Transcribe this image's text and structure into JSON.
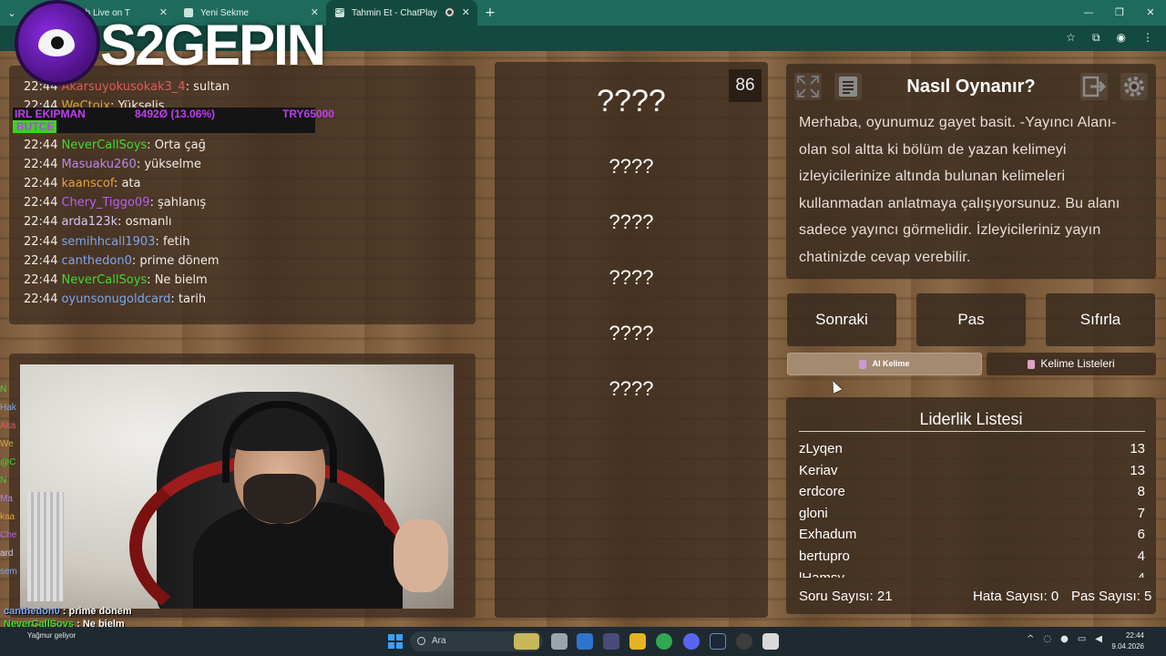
{
  "browser": {
    "tabs": [
      {
        "label": "m - Watch Live on T",
        "favicon": "twitch-icon"
      },
      {
        "label": "Yeni Sekme",
        "favicon": "newtab-icon"
      },
      {
        "label": "Tahmin Et - ChatPlay",
        "favicon": "chatplay-icon",
        "favicon_text": "CP"
      }
    ],
    "new_tab": "+"
  },
  "overlay": {
    "logo_text": "S2GEPIN"
  },
  "chat": {
    "partial_lines": [
      {
        "user": "Akarsuyokusokak3_4",
        "time": "22:44",
        "message": "sultan",
        "color": "#e05a5a"
      },
      {
        "user": "WeCtoix",
        "time": "22:44",
        "message": "Yükselis",
        "color": "#d4a838"
      }
    ],
    "lines": [
      {
        "time": "22:44",
        "user": "NeverCallSoys",
        "message": "Orta çağ",
        "color": "#3fdb2e"
      },
      {
        "time": "22:44",
        "user": "Masuaku260",
        "message": "yükselme",
        "color": "#b688f2"
      },
      {
        "time": "22:44",
        "user": "kaanscof",
        "message": "ata",
        "color": "#e8a23a"
      },
      {
        "time": "22:44",
        "user": "Chery_Tiggo09",
        "message": "şahlanış",
        "color": "#b65ff0"
      },
      {
        "time": "22:44",
        "user": "arda123k",
        "message": "osmanlı",
        "color": "#d3c7f7"
      },
      {
        "time": "22:44",
        "user": "semihhcall1903",
        "message": "fetih",
        "color": "#7aa7f2"
      },
      {
        "time": "22:44",
        "user": "canthedon0",
        "message": "prime dönem",
        "color": "#7aa7f2"
      },
      {
        "time": "22:44",
        "user": "NeverCallSoys",
        "message": "Ne bielm",
        "color": "#3fdb2e"
      },
      {
        "time": "22:44",
        "user": "oyunsonugoldcard",
        "message": "tarih",
        "color": "#7aa7f2"
      }
    ]
  },
  "ticker": {
    "left": "IRL EKIPMAN",
    "mid": "8492Ø (13.06%)",
    "right": "TRY65000",
    "bottom": "BUTCE"
  },
  "cam_side_chat": [
    {
      "text": "N",
      "color": "#3fdb2e"
    },
    {
      "text": "Hak",
      "color": "#7aa7f2"
    },
    {
      "text": "Aka",
      "color": "#e05a5a"
    },
    {
      "text": "We",
      "color": "#d4a838"
    },
    {
      "text": "@C",
      "color": "#3fdb2e"
    },
    {
      "text": "N",
      "color": "#3fdb2e"
    },
    {
      "text": "Ma",
      "color": "#b688f2"
    },
    {
      "text": "kaa",
      "color": "#e8a23a"
    },
    {
      "text": "Che",
      "color": "#b65ff0"
    },
    {
      "text": "ard",
      "color": "#d3c7f7"
    },
    {
      "text": "sem",
      "color": "#7aa7f2"
    }
  ],
  "bottom_chat": [
    {
      "user": "canthedon0",
      "message": "prime dönem"
    },
    {
      "user": "NeverCallSoys",
      "message": "Ne bielm"
    },
    {
      "user": "oyunsonugoldcard",
      "message": "tarih"
    }
  ],
  "game": {
    "counter": "86",
    "words": [
      "????",
      "????",
      "????",
      "????",
      "????",
      "????"
    ],
    "info": {
      "title": "Nasıl Oynanır?",
      "body": "Merhaba, oyunumuz gayet basit. -Yayıncı Alanı-olan sol altta ki bölüm de yazan kelimeyi izleyicilerinize altında bulunan kelimeleri kullanmadan anlatmaya çalışıyorsunuz. Bu alanı sadece yayıncı görmelidir. İzleyicileriniz yayın chatinizde cevap verebilir."
    },
    "buttons": {
      "next": "Sonraki",
      "pass": "Pas",
      "reset": "Sıfırla",
      "ai_word": "AI Kelime",
      "word_lists": "Kelime Listeleri"
    },
    "leaderboard": {
      "title": "Liderlik Listesi",
      "rows": [
        {
          "name": "zLyqen",
          "score": "13"
        },
        {
          "name": "Keriav",
          "score": "13"
        },
        {
          "name": "erdcore",
          "score": "8"
        },
        {
          "name": "gloni",
          "score": "7"
        },
        {
          "name": "Exhadum",
          "score": "6"
        },
        {
          "name": "bertupro",
          "score": "4"
        },
        {
          "name": "lHamsy",
          "score": "4"
        }
      ]
    },
    "stats": {
      "questions": "Soru Sayısı: 21",
      "errors": "Hata Sayısı: 0",
      "passes": "Pas Sayısı: 5"
    }
  },
  "taskbar": {
    "weather": "Yağmur geliyor",
    "search_placeholder": "Ara",
    "time": "22:44",
    "date": "9.04.2026"
  }
}
